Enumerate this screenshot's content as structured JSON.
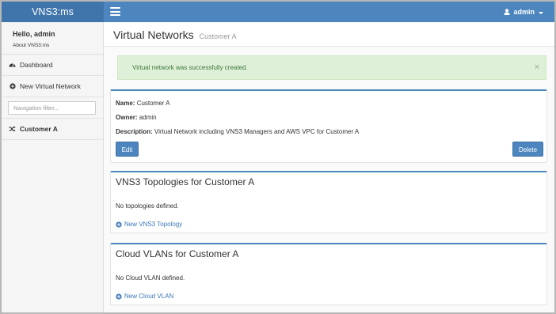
{
  "topbar": {
    "brand": "VNS3:ms",
    "user_label": "admin"
  },
  "sidebar": {
    "greeting": "Hello, admin",
    "about_link": "About VNS3:ms",
    "items": [
      {
        "label": "Dashboard",
        "icon": "dashboard-icon"
      },
      {
        "label": "New Virtual Network",
        "icon": "plus-circle-icon"
      }
    ],
    "filter_placeholder": "Navigation filter...",
    "networks": [
      {
        "label": "Customer A",
        "icon": "shuffle-icon"
      }
    ]
  },
  "main": {
    "title": "Virtual Networks",
    "subtitle": "Customer A",
    "alert": {
      "text": "Virtual network was successfully created.",
      "close": "×"
    },
    "details": {
      "name_label": "Name:",
      "name_value": "Customer A",
      "owner_label": "Owner:",
      "owner_value": "admin",
      "description_label": "Description:",
      "description_value": "Virtual Network including VNS3 Managers and AWS VPC for Customer A",
      "edit_label": "Edit",
      "delete_label": "Delete"
    },
    "topologies": {
      "title": "VNS3 Topologies for Customer A",
      "empty_text": "No topologies defined.",
      "new_link": "New VNS3 Topology"
    },
    "vlans": {
      "title": "Cloud VLANs for Customer A",
      "empty_text": "No Cloud VLAN defined.",
      "new_link": "New Cloud VLAN"
    }
  },
  "colors": {
    "topbar": "#4d86bf",
    "brand_bg": "#3f75ab",
    "alert_bg": "#dff0d8",
    "alert_text": "#3c763d",
    "link": "#3a78b8"
  }
}
